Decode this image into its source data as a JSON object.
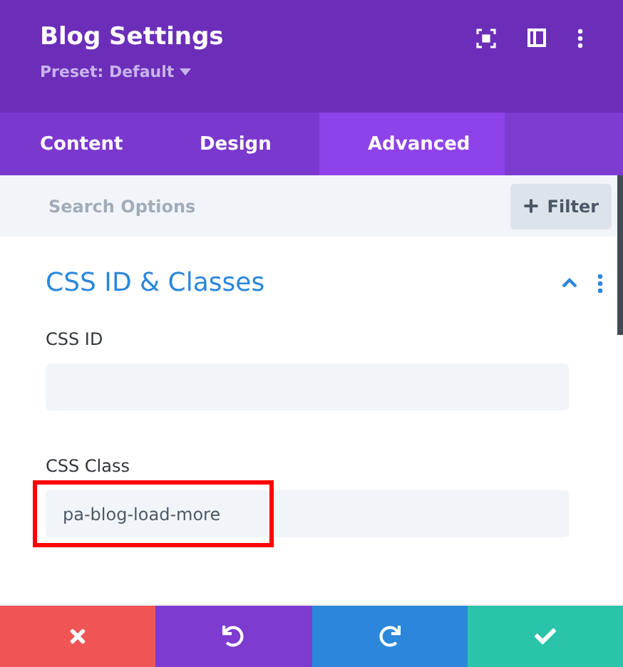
{
  "header": {
    "title": "Blog Settings",
    "preset": "Preset: Default"
  },
  "tabs": [
    {
      "label": "Content",
      "selected": false
    },
    {
      "label": "Design",
      "selected": false
    },
    {
      "label": "Advanced",
      "selected": true
    }
  ],
  "search": {
    "placeholder": "Search Options",
    "filter_label": "Filter"
  },
  "section": {
    "title": "CSS ID & Classes",
    "expanded": true
  },
  "fields": [
    {
      "label": "CSS ID",
      "highlighted": false
    },
    {
      "label": "CSS Class",
      "value": "pa-blog-load-more",
      "highlighted": true
    }
  ],
  "footer_buttons": [
    {
      "kind": "cancel",
      "color": "#ef5555"
    },
    {
      "kind": "undo",
      "color": "#7d3bcf"
    },
    {
      "kind": "redo",
      "color": "#2b87da"
    },
    {
      "kind": "save",
      "color": "#29c4a9"
    }
  ]
}
